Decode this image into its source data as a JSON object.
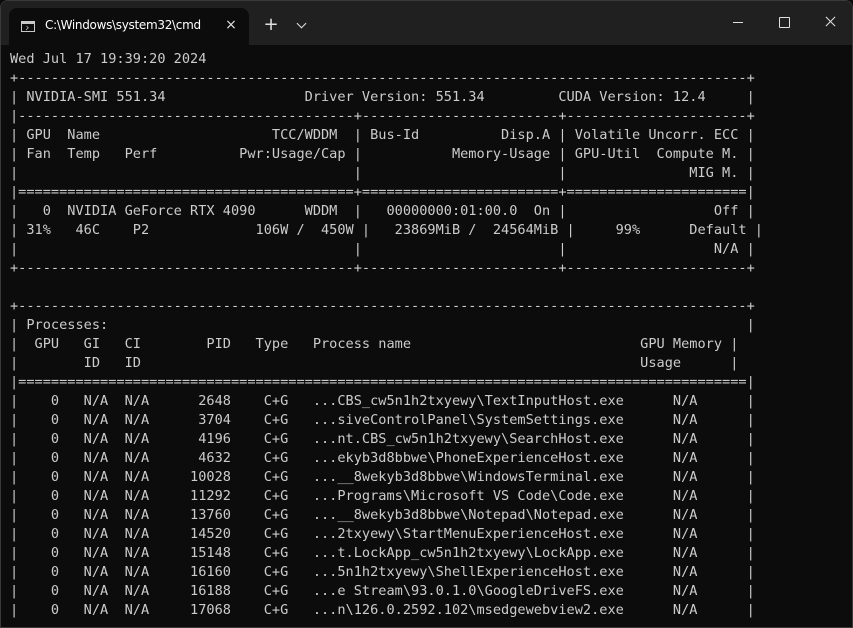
{
  "window": {
    "tab_title": "C:\\Windows\\system32\\cmd",
    "tab_close_glyph": "×",
    "new_tab_glyph": "+"
  },
  "terminal": {
    "lines": [
      "Wed Jul 17 19:39:20 2024",
      "+-----------------------------------------------------------------------------------------+",
      "| NVIDIA-SMI 551.34                 Driver Version: 551.34         CUDA Version: 12.4     |",
      "|-----------------------------------------+------------------------+----------------------+",
      "| GPU  Name                     TCC/WDDM  | Bus-Id          Disp.A | Volatile Uncorr. ECC |",
      "| Fan  Temp   Perf          Pwr:Usage/Cap |           Memory-Usage | GPU-Util  Compute M. |",
      "|                                         |                        |               MIG M. |",
      "|=========================================+========================+======================|",
      "|   0  NVIDIA GeForce RTX 4090      WDDM  |   00000000:01:00.0  On |                  Off |",
      "| 31%   46C    P2             106W /  450W |   23869MiB /  24564MiB |     99%      Default |",
      "|                                         |                        |                  N/A |",
      "+-----------------------------------------+------------------------+----------------------+",
      "",
      "+-----------------------------------------------------------------------------------------+",
      "| Processes:                                                                              |",
      "|  GPU   GI   CI        PID   Type   Process name                            GPU Memory |",
      "|        ID   ID                                                             Usage      |",
      "|=========================================================================================|",
      "|    0   N/A  N/A      2648    C+G   ...CBS_cw5n1h2txyewy\\TextInputHost.exe      N/A      |",
      "|    0   N/A  N/A      3704    C+G   ...siveControlPanel\\SystemSettings.exe      N/A      |",
      "|    0   N/A  N/A      4196    C+G   ...nt.CBS_cw5n1h2txyewy\\SearchHost.exe      N/A      |",
      "|    0   N/A  N/A      4632    C+G   ...ekyb3d8bbwe\\PhoneExperienceHost.exe      N/A      |",
      "|    0   N/A  N/A     10028    C+G   ...__8wekyb3d8bbwe\\WindowsTerminal.exe      N/A      |",
      "|    0   N/A  N/A     11292    C+G   ...Programs\\Microsoft VS Code\\Code.exe      N/A      |",
      "|    0   N/A  N/A     13760    C+G   ...__8wekyb3d8bbwe\\Notepad\\Notepad.exe      N/A      |",
      "|    0   N/A  N/A     14520    C+G   ...2txyewy\\StartMenuExperienceHost.exe      N/A      |",
      "|    0   N/A  N/A     15148    C+G   ...t.LockApp_cw5n1h2txyewy\\LockApp.exe      N/A      |",
      "|    0   N/A  N/A     16160    C+G   ...5n1h2txyewy\\ShellExperienceHost.exe      N/A      |",
      "|    0   N/A  N/A     16188    C+G   ...e Stream\\93.0.1.0\\GoogleDriveFS.exe      N/A      |",
      "|    0   N/A  N/A     17068    C+G   ...n\\126.0.2592.102\\msedgewebview2.exe      N/A      |"
    ]
  },
  "colors": {
    "terminal_bg": "#0c0c0c",
    "terminal_fg": "#cccccc",
    "titlebar_bg": "#202020"
  }
}
